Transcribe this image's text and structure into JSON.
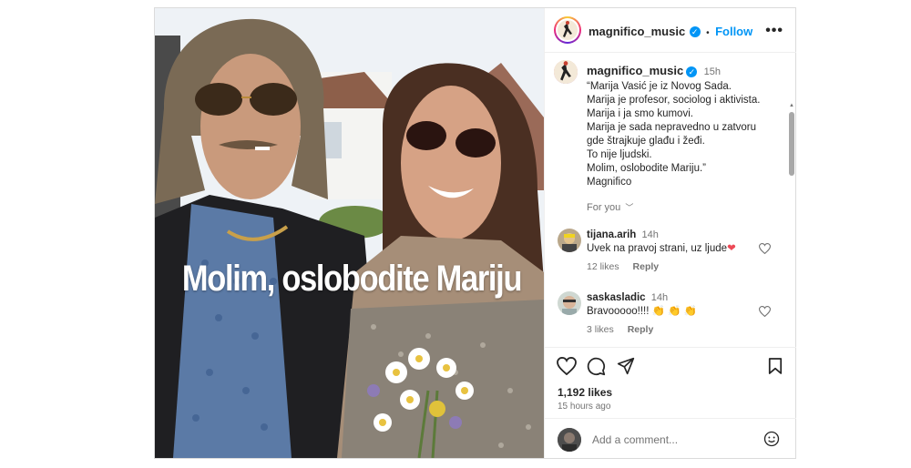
{
  "post": {
    "overlay_text": "Molim, oslobodite Mariju"
  },
  "header": {
    "username": "magnifico_music",
    "separator": "•",
    "follow_label": "Follow",
    "more_label": "•••"
  },
  "caption": {
    "username": "magnifico_music",
    "time": "15h",
    "lines": [
      "“Marija Vasić je iz Novog Sada.",
      "Marija je profesor, sociolog i aktivista.",
      "Marija i ja smo kumovi.",
      "Marija je sada nepravedno u zatvoru",
      "gde štrajkuje glađu i žeđi.",
      "To nije ljudski.",
      "Molim, oslobodite Mariju.”",
      "Magnifico"
    ],
    "for_you": "For you"
  },
  "comments": [
    {
      "username": "tijana.arih",
      "time": "14h",
      "text": "Uvek na pravoj strani, uz ljude",
      "emoji": "❤",
      "likes": "12 likes",
      "reply": "Reply"
    },
    {
      "username": "saskasladic",
      "time": "14h",
      "text": "Bravooooo!!!! ",
      "emoji": "👏 👏 👏",
      "likes": "3 likes",
      "reply": "Reply"
    }
  ],
  "actions": {
    "likes": "1,192 likes",
    "posted": "15 hours ago"
  },
  "add_comment": {
    "placeholder": "Add a comment..."
  },
  "colors": {
    "accent": "#0095f6",
    "muted": "#737373",
    "border": "#dbdbdb"
  }
}
